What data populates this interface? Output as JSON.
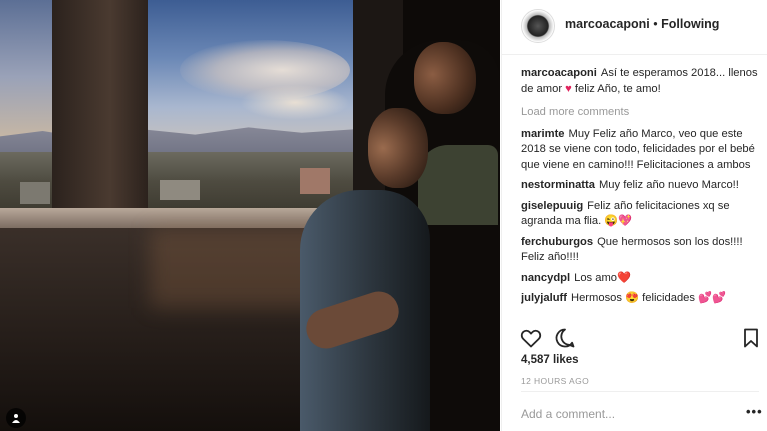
{
  "post": {
    "username": "marcoacaponi",
    "separator": "•",
    "follow_state": "Following",
    "caption": {
      "user": "marcoacaponi",
      "text_before": "Así te esperamos 2018... llenos de amor ",
      "text_after": " feliz Año, te amo!"
    },
    "load_more": "Load more comments",
    "comments": [
      {
        "user": "marimte",
        "text": "Muy Feliz año Marco, veo que este 2018 se viene con todo, felicidades por el bebé que viene en camino!!! Felicitaciones a ambos"
      },
      {
        "user": "nestorminatta",
        "text": "Muy feliz año nuevo Marco!!"
      },
      {
        "user": "giselepuuig",
        "text": "Feliz año felicitaciones xq se agranda ma flia. 😜💖"
      },
      {
        "user": "ferchuburgos",
        "text": "Que hermosos son los dos!!!! Feliz año!!!!"
      },
      {
        "user": "nancydpl",
        "text": "Los amo❤️"
      },
      {
        "user": "julyjaluff",
        "text": "Hermosos 😍 felicidades 💕💕"
      }
    ],
    "likes": "4,587 likes",
    "timestamp": "12 HOURS AGO",
    "add_comment_placeholder": "Add a comment...",
    "more_label": "•••"
  },
  "icons": {
    "like": "heart-outline-icon",
    "comment": "speech-bubble-icon",
    "save": "bookmark-icon",
    "tagged": "user-tag-icon"
  },
  "colors": {
    "text": "#262626",
    "muted": "#999999",
    "heart": "#e0245e",
    "border": "#efefef"
  }
}
